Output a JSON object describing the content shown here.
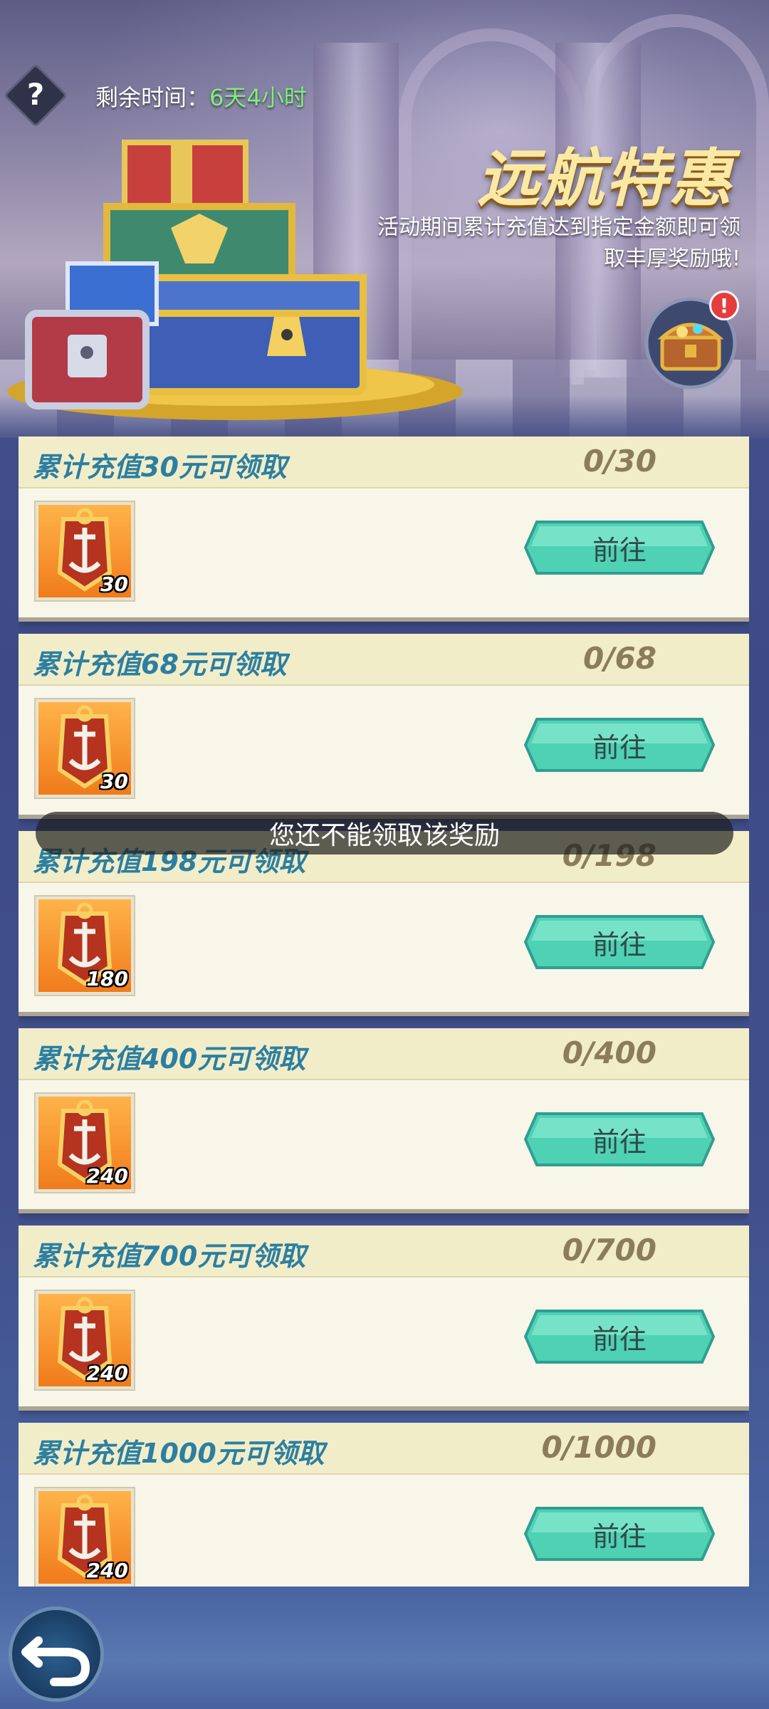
{
  "header": {
    "help_icon": "question-icon",
    "help_symbol": "?",
    "timer_label": "剩余时间：",
    "timer_value": "6天4小时",
    "title": "远航特惠",
    "description_line1": "活动期间累计充值达到指定金额即可领",
    "description_line2": "取丰厚奖励哦!",
    "alert_mark": "!"
  },
  "rewards": [
    {
      "title": "累计充值30元可领取",
      "progress": "0/30",
      "reward_count": "30",
      "button": "前往"
    },
    {
      "title": "累计充值68元可领取",
      "progress": "0/68",
      "reward_count": "30",
      "button": "前往"
    },
    {
      "title": "累计充值198元可领取",
      "progress": "0/198",
      "reward_count": "180",
      "button": "前往"
    },
    {
      "title": "累计充值400元可领取",
      "progress": "0/400",
      "reward_count": "240",
      "button": "前往"
    },
    {
      "title": "累计充值700元可领取",
      "progress": "0/700",
      "reward_count": "240",
      "button": "前往"
    },
    {
      "title": "累计充值1000元可领取",
      "progress": "0/1000",
      "reward_count": "240",
      "button": "前往"
    }
  ],
  "toast": "您还不能领取该奖励",
  "colors": {
    "title_text": "#2c7fa0",
    "button": "#4fd1b4",
    "timer_value": "#7df07a",
    "reward_bg": "#f07b1b"
  }
}
